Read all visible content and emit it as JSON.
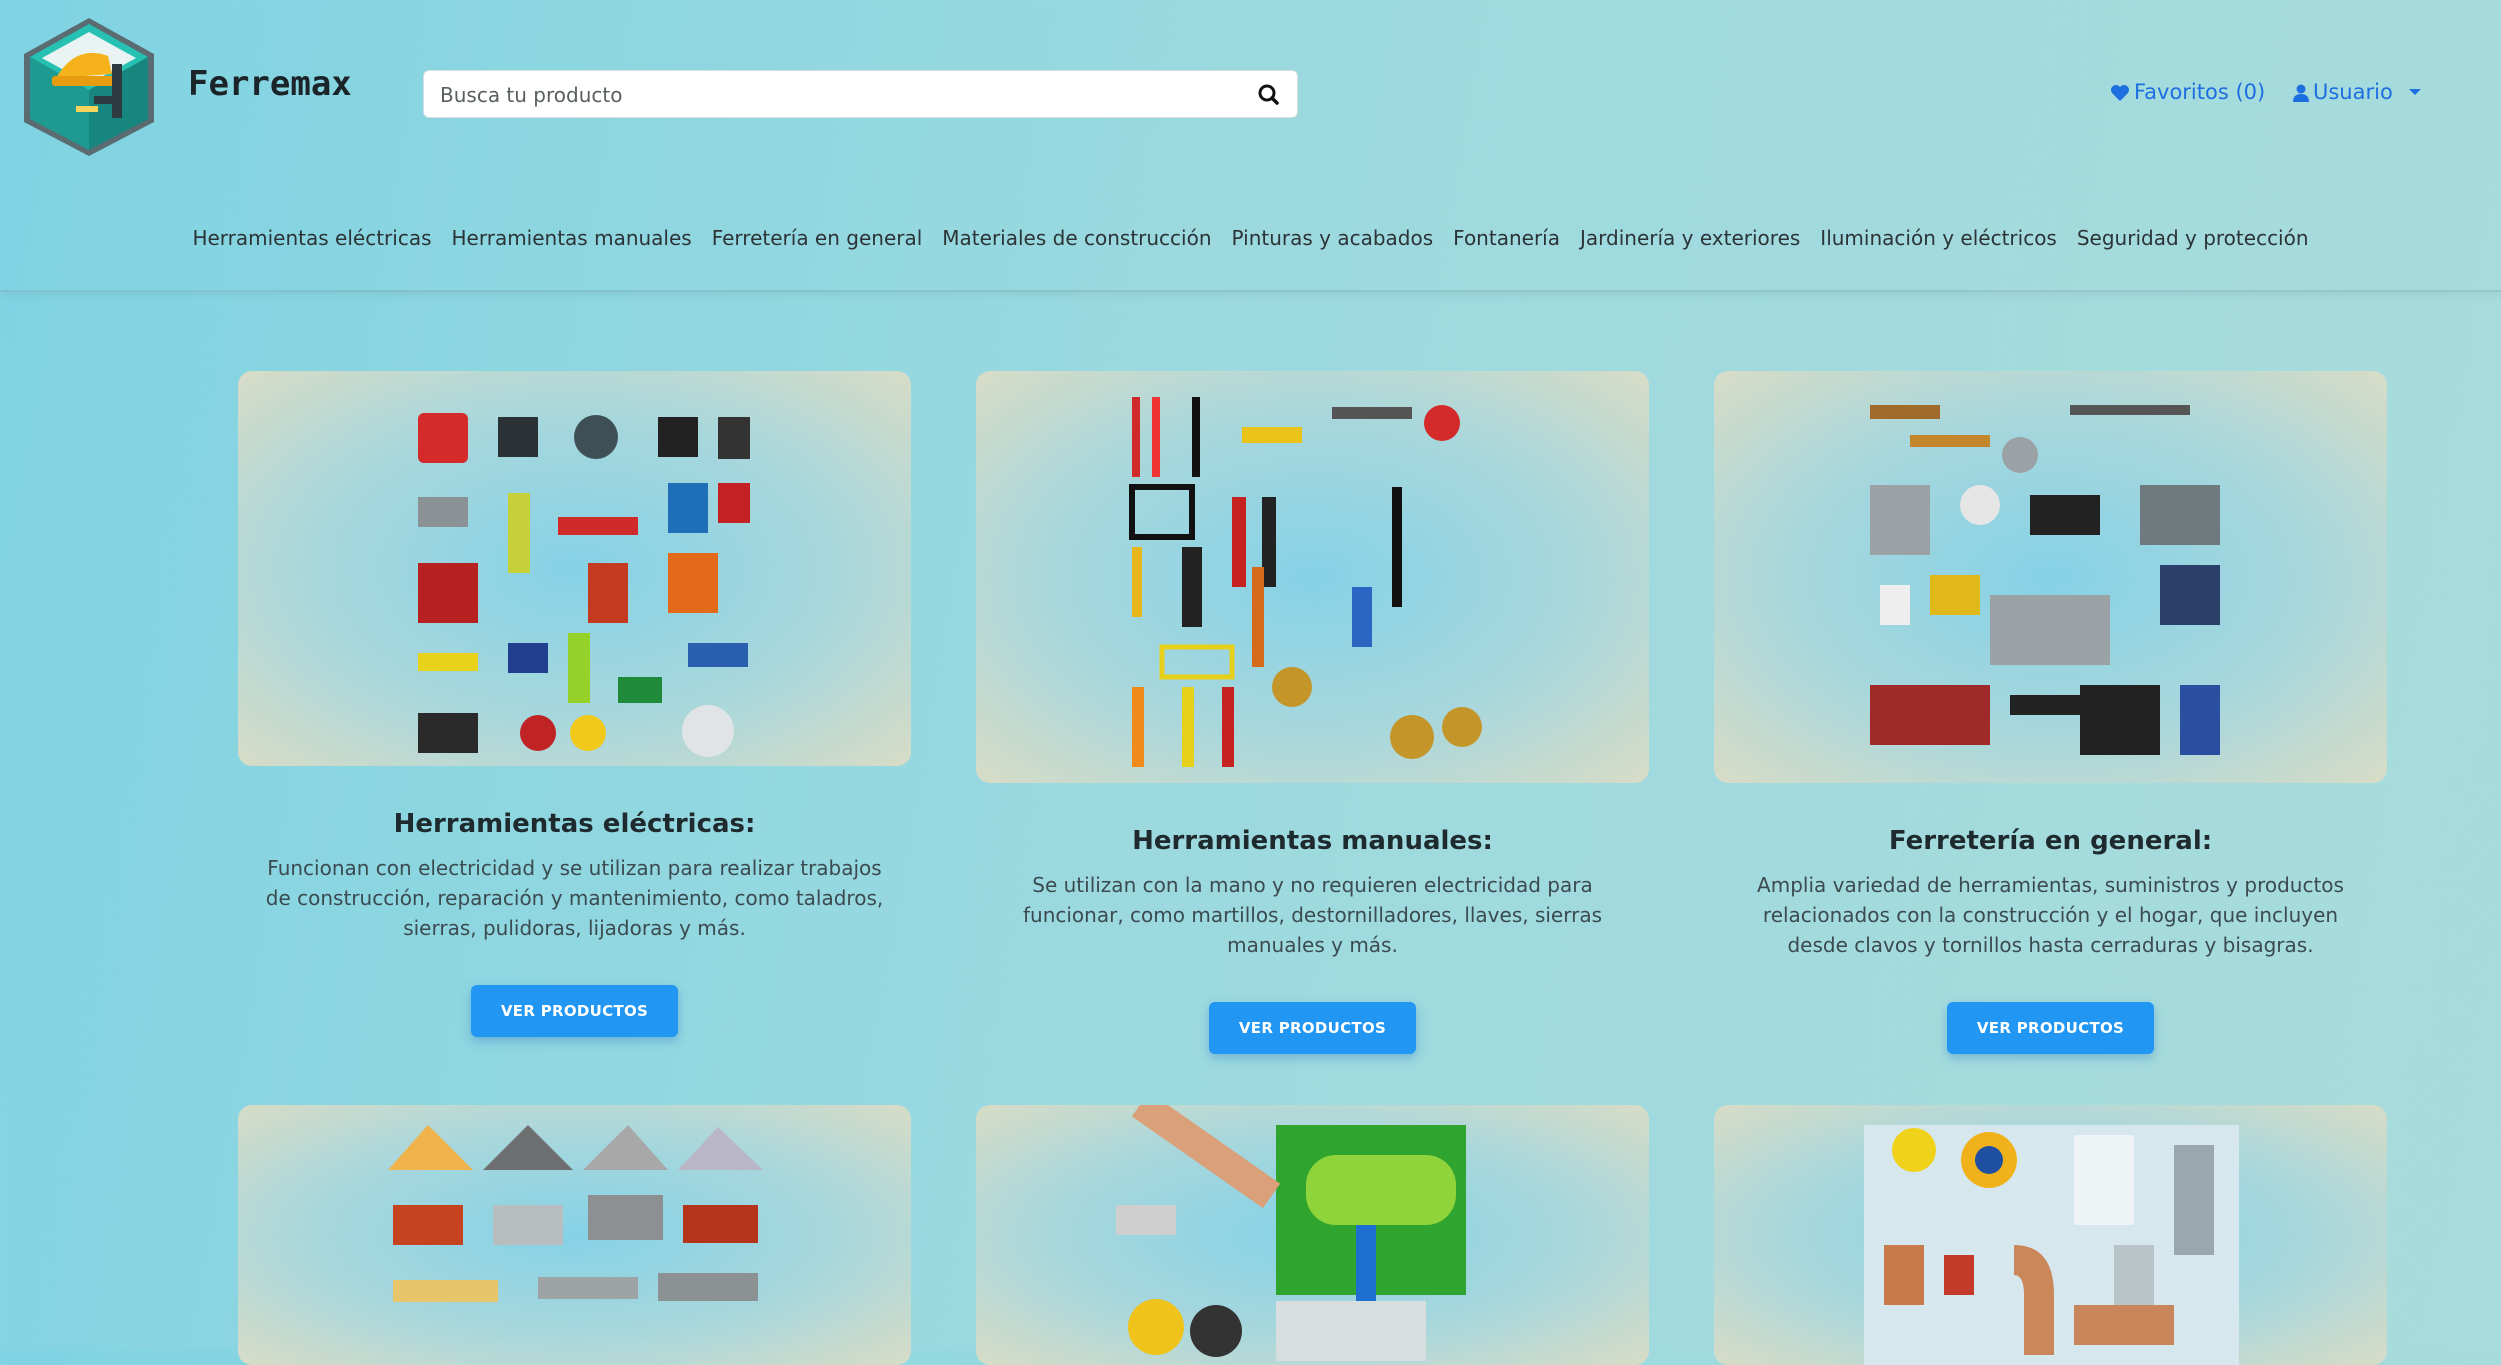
{
  "brand": {
    "name": "Ferremax"
  },
  "search": {
    "placeholder": "Busca tu producto"
  },
  "topbar": {
    "favorites_label": "Favoritos (0)",
    "user_label": "Usuario"
  },
  "nav": {
    "items": [
      "Herramientas eléctricas",
      "Herramientas manuales",
      "Ferretería en general",
      "Materiales de construcción",
      "Pinturas y acabados",
      "Fontanería",
      "Jardinería y exteriores",
      "Iluminación y eléctricos",
      "Seguridad y protección"
    ]
  },
  "cards": [
    {
      "title": "Herramientas eléctricas:",
      "description": "Funcionan con electricidad y se utilizan para realizar trabajos de construcción, reparación y mantenimiento, como taladros, sierras, pulidoras, lijadoras y más.",
      "button": "VER PRODUCTOS"
    },
    {
      "title": "Herramientas manuales:",
      "description": "Se utilizan con la mano y no requieren electricidad para funcionar, como martillos, destornilladores, llaves, sierras manuales y más.",
      "button": "VER PRODUCTOS"
    },
    {
      "title": "Ferretería en general:",
      "description": "Amplia variedad de herramientas, suministros y productos relacionados con la construcción y el hogar, que incluyen desde clavos y tornillos hasta cerraduras y bisagras.",
      "button": "VER PRODUCTOS"
    }
  ],
  "colors": {
    "accent": "#2196f3",
    "link": "#1d6fe0",
    "logo_teal": "#1fb5a8"
  },
  "icons": [
    "logo-icon",
    "search-icon",
    "heart-icon",
    "user-icon",
    "caret-down-icon"
  ]
}
